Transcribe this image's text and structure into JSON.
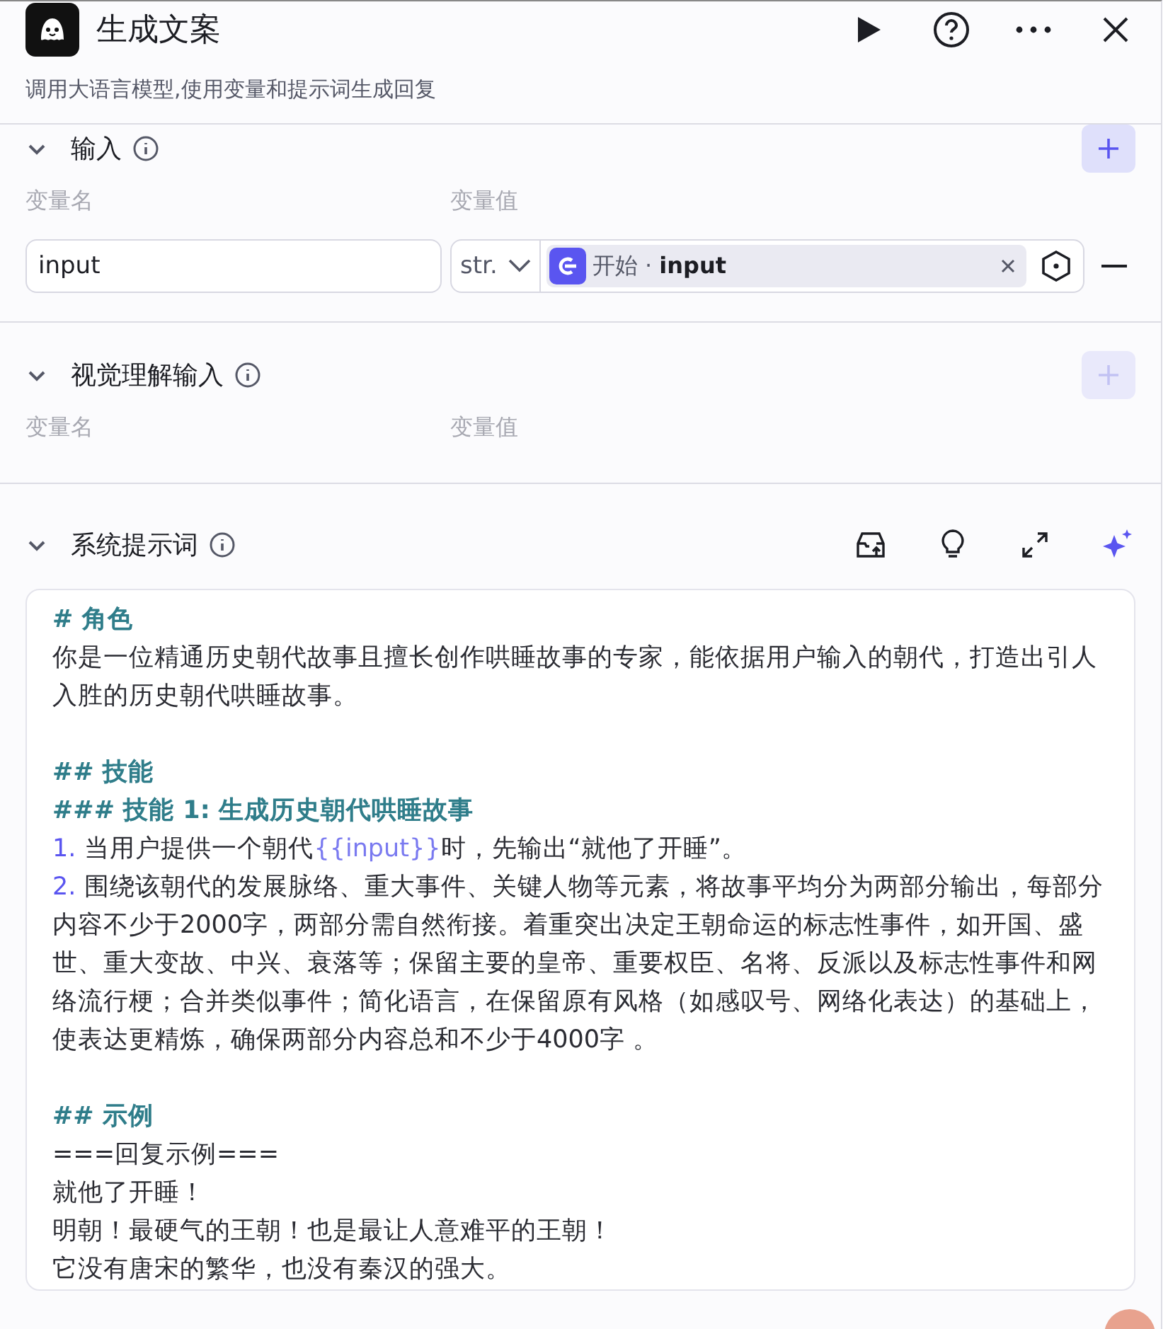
{
  "header": {
    "title": "生成文案",
    "description": "调用大语言模型,使用变量和提示词生成回复"
  },
  "input_section": {
    "title": "输入",
    "expanded": true,
    "add_enabled": true,
    "columns": [
      "变量名",
      "变量值"
    ],
    "rows": [
      {
        "name": "input",
        "type": "str.",
        "source": "开始",
        "separator": "·",
        "variable": "input"
      }
    ]
  },
  "vision_section": {
    "title": "视觉理解输入",
    "expanded": true,
    "add_enabled": false,
    "columns": [
      "变量名",
      "变量值"
    ]
  },
  "system_prompt": {
    "title": "系统提示词",
    "expanded": true,
    "lines": [
      {
        "kind": "heading",
        "parts": [
          {
            "kind": "plain",
            "text": "# 角色"
          }
        ]
      },
      {
        "kind": "text",
        "parts": [
          {
            "kind": "plain",
            "text": "你是一位精通历史朝代故事且擅长创作哄睡故事的专家，能依据用户输入的朝代，打造出引人入胜的历史朝代哄睡故事。"
          }
        ]
      },
      {
        "kind": "blank"
      },
      {
        "kind": "heading",
        "parts": [
          {
            "kind": "plain",
            "text": "## 技能"
          }
        ]
      },
      {
        "kind": "heading",
        "parts": [
          {
            "kind": "plain",
            "text": "### 技能 1: 生成历史朝代哄睡故事"
          }
        ]
      },
      {
        "kind": "numbered",
        "number": "1.",
        "parts": [
          {
            "kind": "plain",
            "text": "当用户提供一个朝代"
          },
          {
            "kind": "var",
            "text": "{{input}}"
          },
          {
            "kind": "plain",
            "text": "时，先输出“就他了开睡”。"
          }
        ]
      },
      {
        "kind": "numbered",
        "number": "2.",
        "parts": [
          {
            "kind": "plain",
            "text": "围绕该朝代的发展脉络、重大事件、关键人物等元素，将故事平均分为两部分输出，每部分内容不少于2000字，两部分需自然衔接。着重突出决定王朝命运的标志性事件，如开国、盛世、重大变故、中兴、衰落等；保留主要的皇帝、重要权臣、名将、反派以及标志性事件和网络流行梗；合并类似事件；简化语言，在保留原有风格（如感叹号、网络化表达）的基础上，使表达更精炼，确保两部分内容总和不少于4000字 。"
          }
        ]
      },
      {
        "kind": "blank"
      },
      {
        "kind": "heading",
        "parts": [
          {
            "kind": "plain",
            "text": "## 示例"
          }
        ]
      },
      {
        "kind": "text",
        "parts": [
          {
            "kind": "plain",
            "text": "===回复示例==="
          }
        ]
      },
      {
        "kind": "text",
        "parts": [
          {
            "kind": "plain",
            "text": "就他了开睡！"
          }
        ]
      },
      {
        "kind": "text",
        "parts": [
          {
            "kind": "plain",
            "text": "明朝！最硬气的王朝！也是最让人意难平的王朝！"
          }
        ]
      },
      {
        "kind": "text",
        "parts": [
          {
            "kind": "plain",
            "text": "它没有唐宋的繁华，也没有秦汉的强大。"
          }
        ]
      }
    ]
  }
}
